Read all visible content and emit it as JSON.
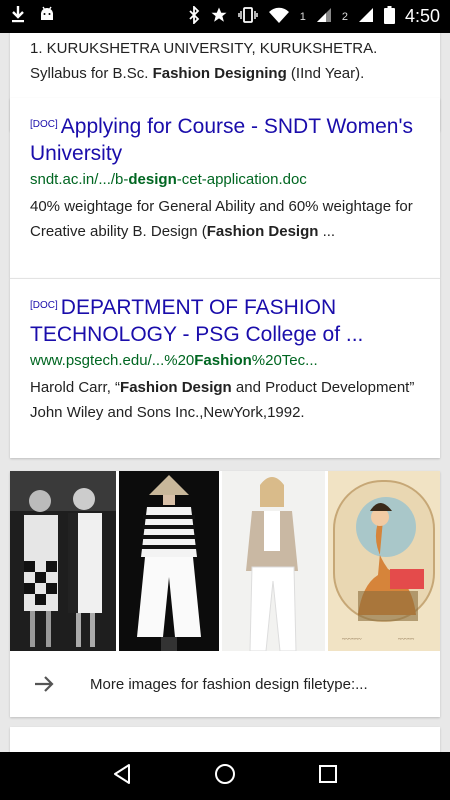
{
  "status_bar": {
    "time": "4:50",
    "sim1": "1",
    "sim2": "2",
    "icons": [
      "download-icon",
      "android-icon",
      "bluetooth-icon",
      "star-icon",
      "vibrate-icon",
      "wifi-icon",
      "signal-icon",
      "battery-icon"
    ]
  },
  "results": [
    {
      "snippet_parts": [
        {
          "text": "1. KURUKSHETRA UNIVERSITY, KURUKSHETRA. Syllabus for B.Sc. ",
          "bold": false
        },
        {
          "text": "Fashion Designing",
          "bold": true
        },
        {
          "text": " (IInd Year).",
          "bold": false
        }
      ]
    },
    {
      "tag": "[DOC]",
      "title": "Applying for Course - SNDT Women's University",
      "url_parts": [
        {
          "text": "sndt.ac.in/.../b-",
          "bold": false
        },
        {
          "text": "design",
          "bold": true
        },
        {
          "text": "-cet-application.doc",
          "bold": false
        }
      ],
      "snippet_parts": [
        {
          "text": "40% weightage for General Ability and 60% weightage for Creative ability B. Design (",
          "bold": false
        },
        {
          "text": "Fashion Design",
          "bold": true
        },
        {
          "text": " ...",
          "bold": false
        }
      ]
    },
    {
      "tag": "[DOC]",
      "title": "DEPARTMENT OF FASHION TECHNOLOGY - PSG College of ...",
      "url_parts": [
        {
          "text": "www.psgtech.edu/...%20",
          "bold": false
        },
        {
          "text": "Fashion",
          "bold": true
        },
        {
          "text": "%20Tec...",
          "bold": false
        }
      ],
      "snippet_parts": [
        {
          "text": "Harold Carr, “",
          "bold": false
        },
        {
          "text": "Fashion Design",
          "bold": true
        },
        {
          "text": " and Product Development” John Wiley and Sons Inc.,NewYork,1992.",
          "bold": false
        }
      ]
    }
  ],
  "images": {
    "thumbnails": [
      "mod-dresses-photo",
      "striped-outfit-photo",
      "white-trousers-photo",
      "fashion-illustration-photo"
    ],
    "more_label": "More images for fashion design filetype:..."
  },
  "colors": {
    "link": "#1a0dab",
    "url": "#006621",
    "text": "#222222"
  }
}
